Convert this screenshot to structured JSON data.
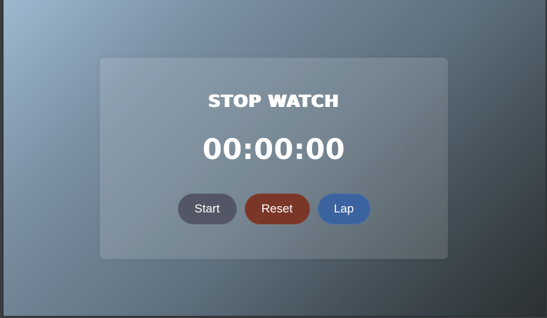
{
  "app": {
    "title": "STOP WATCH",
    "time": "00:00:00"
  },
  "controls": {
    "start_label": "Start",
    "reset_label": "Reset",
    "lap_label": "Lap"
  },
  "colors": {
    "start_button": "#535664",
    "reset_button": "#7a3626",
    "lap_button": "#3a639f",
    "text": "#ffffff"
  }
}
